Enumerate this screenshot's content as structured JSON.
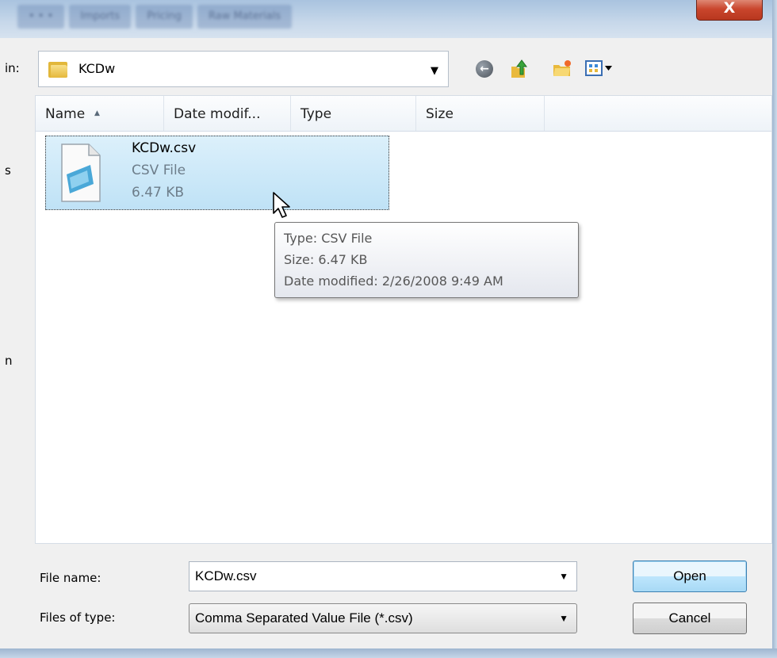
{
  "window": {
    "background_tabs": [
      "• • •",
      "Imports",
      "Pricing",
      "Raw Materials"
    ],
    "close_glyph": "X"
  },
  "look_in": {
    "label": "in:",
    "value": "KCDw"
  },
  "columns": {
    "name": "Name",
    "date": "Date modif...",
    "type": "Type",
    "size": "Size"
  },
  "file": {
    "name": "KCDw.csv",
    "type": "CSV File",
    "size": "6.47 KB"
  },
  "tooltip": {
    "type_line": "Type: CSV File",
    "size_line": "Size: 6.47 KB",
    "date_line": "Date modified: 2/26/2008 9:49 AM"
  },
  "sidebar_fragments": {
    "first": "s",
    "second": "n"
  },
  "file_name_field": {
    "label": "File name:",
    "value": "KCDw.csv"
  },
  "file_type_field": {
    "label": "Files of type:",
    "value": "Comma Separated Value File (*.csv)"
  },
  "buttons": {
    "open": "Open",
    "cancel": "Cancel"
  },
  "colors": {
    "selection": "#c6e6f8",
    "default_button": "#bee6fd",
    "close_button": "#c9452c"
  }
}
